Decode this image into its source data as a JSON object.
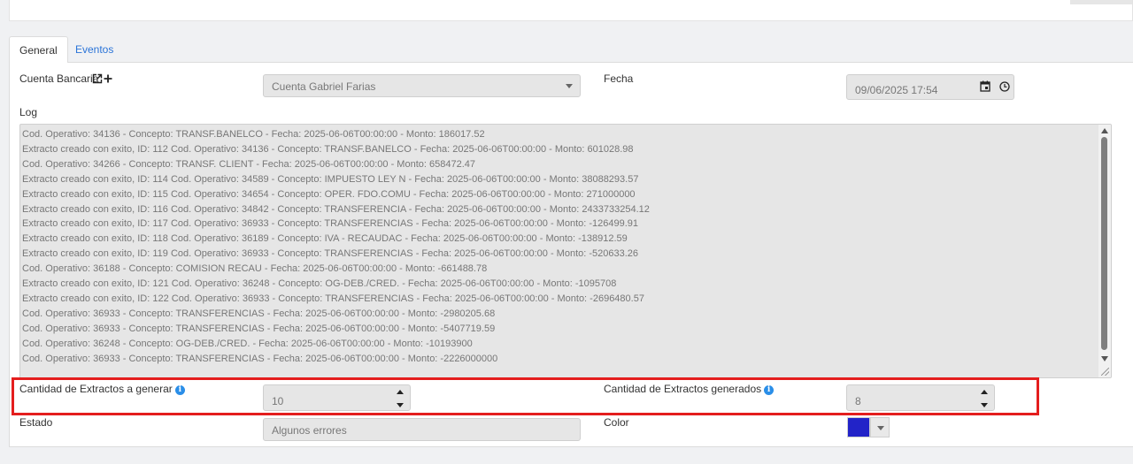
{
  "tabs": {
    "general": "General",
    "eventos": "Eventos"
  },
  "form": {
    "cuenta_label": "Cuenta Bancaria",
    "cuenta_value": "Cuenta Gabriel Farias",
    "fecha_label": "Fecha",
    "fecha_value": "09/06/2025 17:54",
    "log_label": "Log",
    "cantidad_generar_label": "Cantidad de Extractos a generar",
    "cantidad_generar_value": "10",
    "cantidad_generados_label": "Cantidad de Extractos generados",
    "cantidad_generados_value": "8",
    "estado_label": "Estado",
    "estado_value": "Algunos errores",
    "color_label": "Color",
    "color_value": "#2223c8"
  },
  "log_lines": [
    "Cod. Operativo: 34136 - Concepto: TRANSF.BANELCO - Fecha: 2025-06-06T00:00:00 - Monto: 186017.52",
    "Extracto creado con exito, ID: 112  Cod. Operativo: 34136 - Concepto: TRANSF.BANELCO - Fecha: 2025-06-06T00:00:00 - Monto: 601028.98",
    "Cod. Operativo: 34266 - Concepto: TRANSF. CLIENT - Fecha: 2025-06-06T00:00:00 - Monto: 658472.47",
    "Extracto creado con exito, ID: 114  Cod. Operativo: 34589 - Concepto: IMPUESTO LEY N - Fecha: 2025-06-06T00:00:00 - Monto: 38088293.57",
    "Extracto creado con exito, ID: 115  Cod. Operativo: 34654 - Concepto: OPER. FDO.COMU - Fecha: 2025-06-06T00:00:00 - Monto: 271000000",
    "Extracto creado con exito, ID: 116  Cod. Operativo: 34842 - Concepto: TRANSFERENCIA - Fecha: 2025-06-06T00:00:00 - Monto: 2433733254.12",
    "Extracto creado con exito, ID: 117  Cod. Operativo: 36933 - Concepto: TRANSFERENCIAS - Fecha: 2025-06-06T00:00:00 - Monto: -126499.91",
    "Extracto creado con exito, ID: 118  Cod. Operativo: 36189 - Concepto: IVA  - RECAUDAC - Fecha: 2025-06-06T00:00:00 - Monto: -138912.59",
    "Extracto creado con exito, ID: 119  Cod. Operativo: 36933 - Concepto: TRANSFERENCIAS - Fecha: 2025-06-06T00:00:00 - Monto: -520633.26",
    "Cod. Operativo: 36188 - Concepto: COMISION RECAU - Fecha: 2025-06-06T00:00:00 - Monto: -661488.78",
    "Extracto creado con exito, ID: 121  Cod. Operativo: 36248 - Concepto: OG-DEB./CRED. - Fecha: 2025-06-06T00:00:00 - Monto: -1095708",
    "Extracto creado con exito, ID: 122  Cod. Operativo: 36933 - Concepto: TRANSFERENCIAS - Fecha: 2025-06-06T00:00:00 - Monto: -2696480.57",
    "Cod. Operativo: 36933 - Concepto: TRANSFERENCIAS - Fecha: 2025-06-06T00:00:00 - Monto: -2980205.68",
    "Cod. Operativo: 36933 - Concepto: TRANSFERENCIAS - Fecha: 2025-06-06T00:00:00 - Monto: -5407719.59",
    "Cod. Operativo: 36248 - Concepto: OG-DEB./CRED. - Fecha: 2025-06-06T00:00:00 - Monto: -10193900",
    "Cod. Operativo: 36933 - Concepto: TRANSFERENCIAS - Fecha: 2025-06-06T00:00:00 - Monto: -2226000000"
  ],
  "icons": {
    "external_link": "external-link-icon",
    "add": "plus-icon",
    "calendar": "calendar-icon",
    "clock": "clock-icon",
    "info": "info-icon"
  }
}
